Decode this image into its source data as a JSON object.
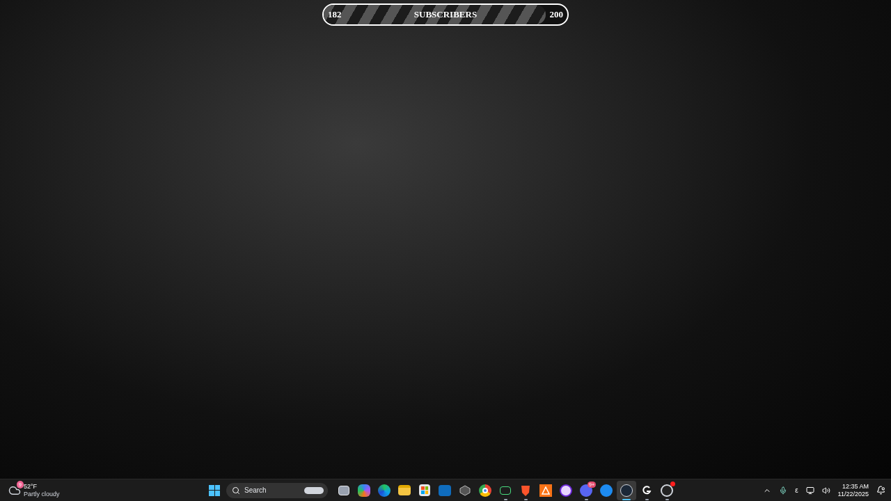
{
  "subscriber_bar": {
    "current": "182",
    "label": "SUBSCRIBERS",
    "goal": "200",
    "level": 0.91
  },
  "taskbar": {
    "weather": {
      "badge": "9",
      "temperature": "52°F",
      "condition": "Partly cloudy"
    },
    "search": {
      "placeholder": "Search"
    },
    "apps": [
      {
        "kind": "taskview",
        "running": false,
        "active": false
      },
      {
        "kind": "copilot",
        "running": false,
        "active": false
      },
      {
        "kind": "edge",
        "running": false,
        "active": false
      },
      {
        "kind": "folder",
        "running": false,
        "active": false
      },
      {
        "kind": "store",
        "running": false,
        "active": false
      },
      {
        "kind": "mail",
        "running": false,
        "active": false
      },
      {
        "kind": "cube",
        "running": false,
        "active": false
      },
      {
        "kind": "chrome",
        "running": false,
        "active": false
      },
      {
        "kind": "sheet",
        "running": true,
        "active": false
      },
      {
        "kind": "lion",
        "running": true,
        "active": false
      },
      {
        "kind": "orange",
        "running": false,
        "active": false
      },
      {
        "kind": "purple",
        "running": false,
        "active": false
      },
      {
        "kind": "chat",
        "running": true,
        "active": false,
        "badge": "9+"
      },
      {
        "kind": "bluearrow",
        "running": false,
        "active": false
      },
      {
        "kind": "steam",
        "running": true,
        "active": true
      },
      {
        "kind": "g",
        "running": true,
        "active": false
      },
      {
        "kind": "record",
        "running": true,
        "active": false,
        "dot": true
      }
    ],
    "tray": {
      "language": "ε",
      "time": "12:35 AM",
      "date": "11/22/2025"
    }
  }
}
